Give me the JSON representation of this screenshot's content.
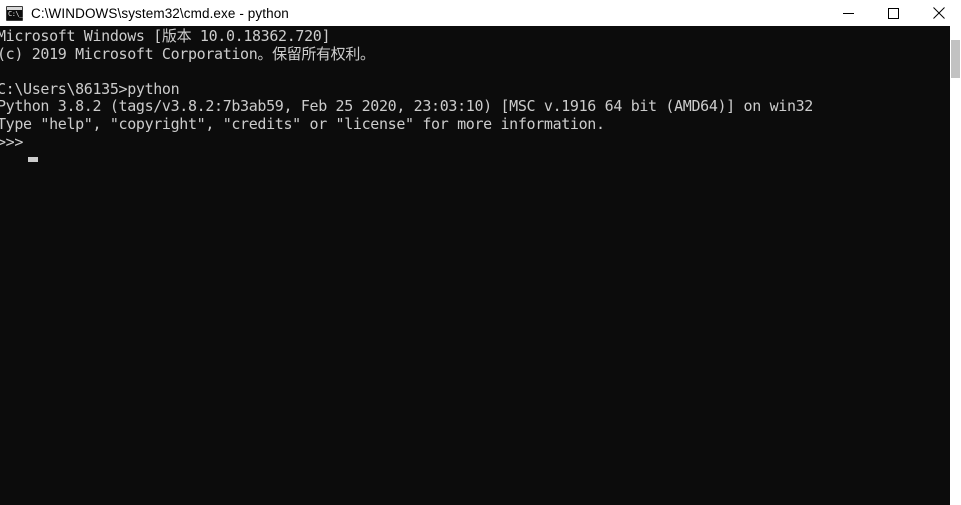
{
  "window": {
    "title": "C:\\WINDOWS\\system32\\cmd.exe - python",
    "icon_name": "cmd-console-icon",
    "icon_glyph": "C:\\_",
    "background_color": "#0c0c0c",
    "text_color": "#cccccc",
    "titlebar_color": "#ffffff"
  },
  "controls": {
    "minimize_label": "Minimize",
    "maximize_label": "Maximize",
    "close_label": "Close"
  },
  "console": {
    "lines": [
      "Microsoft Windows [版本 10.0.18362.720]",
      "(c) 2019 Microsoft Corporation。保留所有权利。",
      "",
      "C:\\Users\\86135>python",
      "Python 3.8.2 (tags/v3.8.2:7b3ab59, Feb 25 2020, 23:03:10) [MSC v.1916 64 bit (AMD64)] on win32",
      "Type \"help\", \"copyright\", \"credits\" or \"license\" for more information.",
      ">>>"
    ],
    "text": "Microsoft Windows [版本 10.0.18362.720]\n(c) 2019 Microsoft Corporation。保留所有权利。\n\nC:\\Users\\86135>python\nPython 3.8.2 (tags/v3.8.2:7b3ab59, Feb 25 2020, 23:03:10) [MSC v.1916 64 bit (AMD64)] on win32\nType \"help\", \"copyright\", \"credits\" or \"license\" for more information.\n>>>",
    "prompt": ">>>",
    "cursor_visible": true
  },
  "scrollbar": {
    "orientation": "vertical",
    "thumb_position_percent": 3
  }
}
